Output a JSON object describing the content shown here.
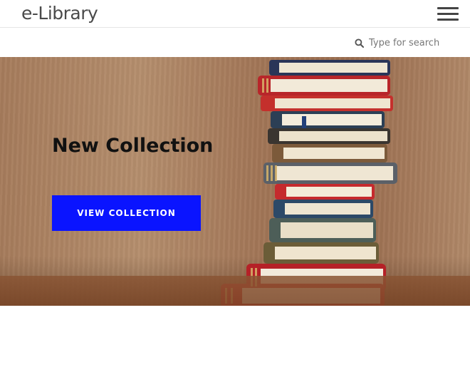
{
  "header": {
    "logo_text": "e-Library",
    "menu_icon": "hamburger-menu-icon"
  },
  "search": {
    "icon": "search-icon",
    "placeholder": "Type for search"
  },
  "hero": {
    "title": "New Collection",
    "button_label": "VIEW COLLECTION",
    "button_color": "#0a14ff"
  },
  "colors": {
    "accent": "#0a14ff",
    "logo_text": "#4a4a4a",
    "title_text": "#111111"
  }
}
